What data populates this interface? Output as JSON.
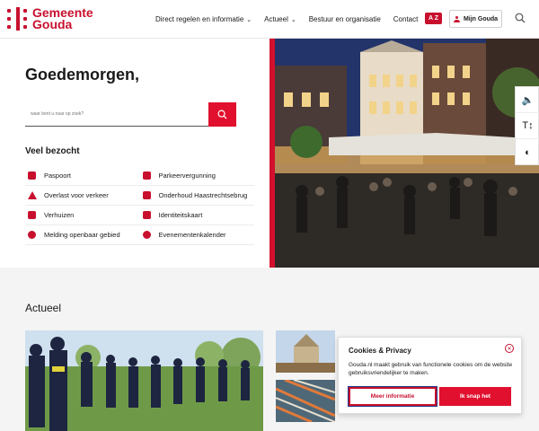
{
  "header": {
    "logo_line1": "Gemeente",
    "logo_line2": "Gouda",
    "nav": [
      {
        "label": "Direct regelen en informatie",
        "chevron": "⌄"
      },
      {
        "label": "Actueel",
        "chevron": "⌄"
      },
      {
        "label": "Bestuur en organisatie",
        "chevron": ""
      },
      {
        "label": "Contact",
        "chevron": ""
      }
    ],
    "az_label": "A Z",
    "mijn_label": "Mijn Gouda"
  },
  "hero": {
    "greeting": "Goedemorgen,",
    "search_placeholder": "waar bent u naar op zoek?",
    "veel_bezocht": "Veel bezocht",
    "quick_links": [
      [
        "Paspoort",
        "Parkeervergunning"
      ],
      [
        "Overlast voor verkeer",
        "Onderhoud Haastrechtsebrug"
      ],
      [
        "Verhuizen",
        "Identiteitskaart"
      ],
      [
        "Melding openbaar gebied",
        "Evenementenkalender"
      ]
    ]
  },
  "tools": {
    "audio": "🔈",
    "text_size": "T↕",
    "contrast": "◐"
  },
  "actueel": {
    "title": "Actueel"
  },
  "cookie": {
    "title": "Cookies & Privacy",
    "close": "✕",
    "text": "Gouda.nl maakt gebruik van functionele cookies om de website gebruiksvriendelijker te maken.",
    "more_label": "Meer informatie",
    "ok_label": "Ik snap het"
  },
  "colors": {
    "brand": "#c8102e",
    "accent": "#e0102e"
  }
}
